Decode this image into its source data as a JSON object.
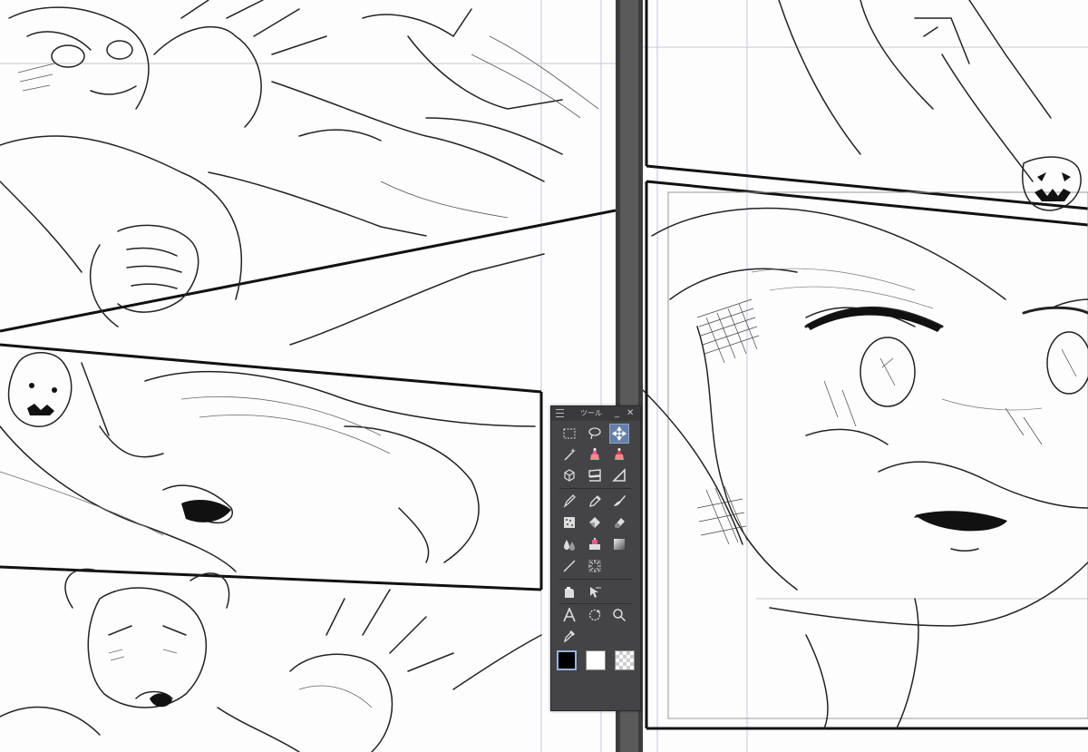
{
  "palette": {
    "title": "ツール",
    "minimize_glyph": "_",
    "close_glyph": "✕"
  },
  "tools": [
    {
      "name": "rect-select-tool-icon"
    },
    {
      "name": "lasso-select-tool-icon"
    },
    {
      "name": "move-tool-icon",
      "selected": true
    },
    {
      "name": "magic-wand-tool-icon"
    },
    {
      "name": "auto-select-tool-icon"
    },
    {
      "name": "sub-select-tool-icon"
    },
    {
      "name": "object-select-tool-icon"
    },
    {
      "name": "frame-border-tool-icon"
    },
    {
      "name": "ruler-tool-icon"
    },
    {
      "name": "pen-tool-icon"
    },
    {
      "name": "pencil-tool-icon"
    },
    {
      "name": "brush-tool-icon"
    },
    {
      "name": "airbrush-tool-icon"
    },
    {
      "name": "fill-tool-icon"
    },
    {
      "name": "eraser-tool-icon"
    },
    {
      "name": "blend-tool-icon"
    },
    {
      "name": "decoration-tool-icon"
    },
    {
      "name": "gradient-tool-icon"
    },
    {
      "name": "figure-line-tool-icon"
    },
    {
      "name": "speed-lines-tool-icon"
    },
    {
      "name": "balloon-tool-icon"
    },
    {
      "name": "correct-line-tool-icon"
    },
    {
      "name": "text-tool-icon"
    },
    {
      "name": "operation-rotate-tool-icon"
    },
    {
      "name": "zoom-tool-icon"
    },
    {
      "name": "eyedropper-tool-icon"
    }
  ],
  "colors": {
    "main_color": "#000000",
    "sub_color": "#ffffff",
    "accent_selected": "#667fa6",
    "palette_bg": "#444446"
  }
}
